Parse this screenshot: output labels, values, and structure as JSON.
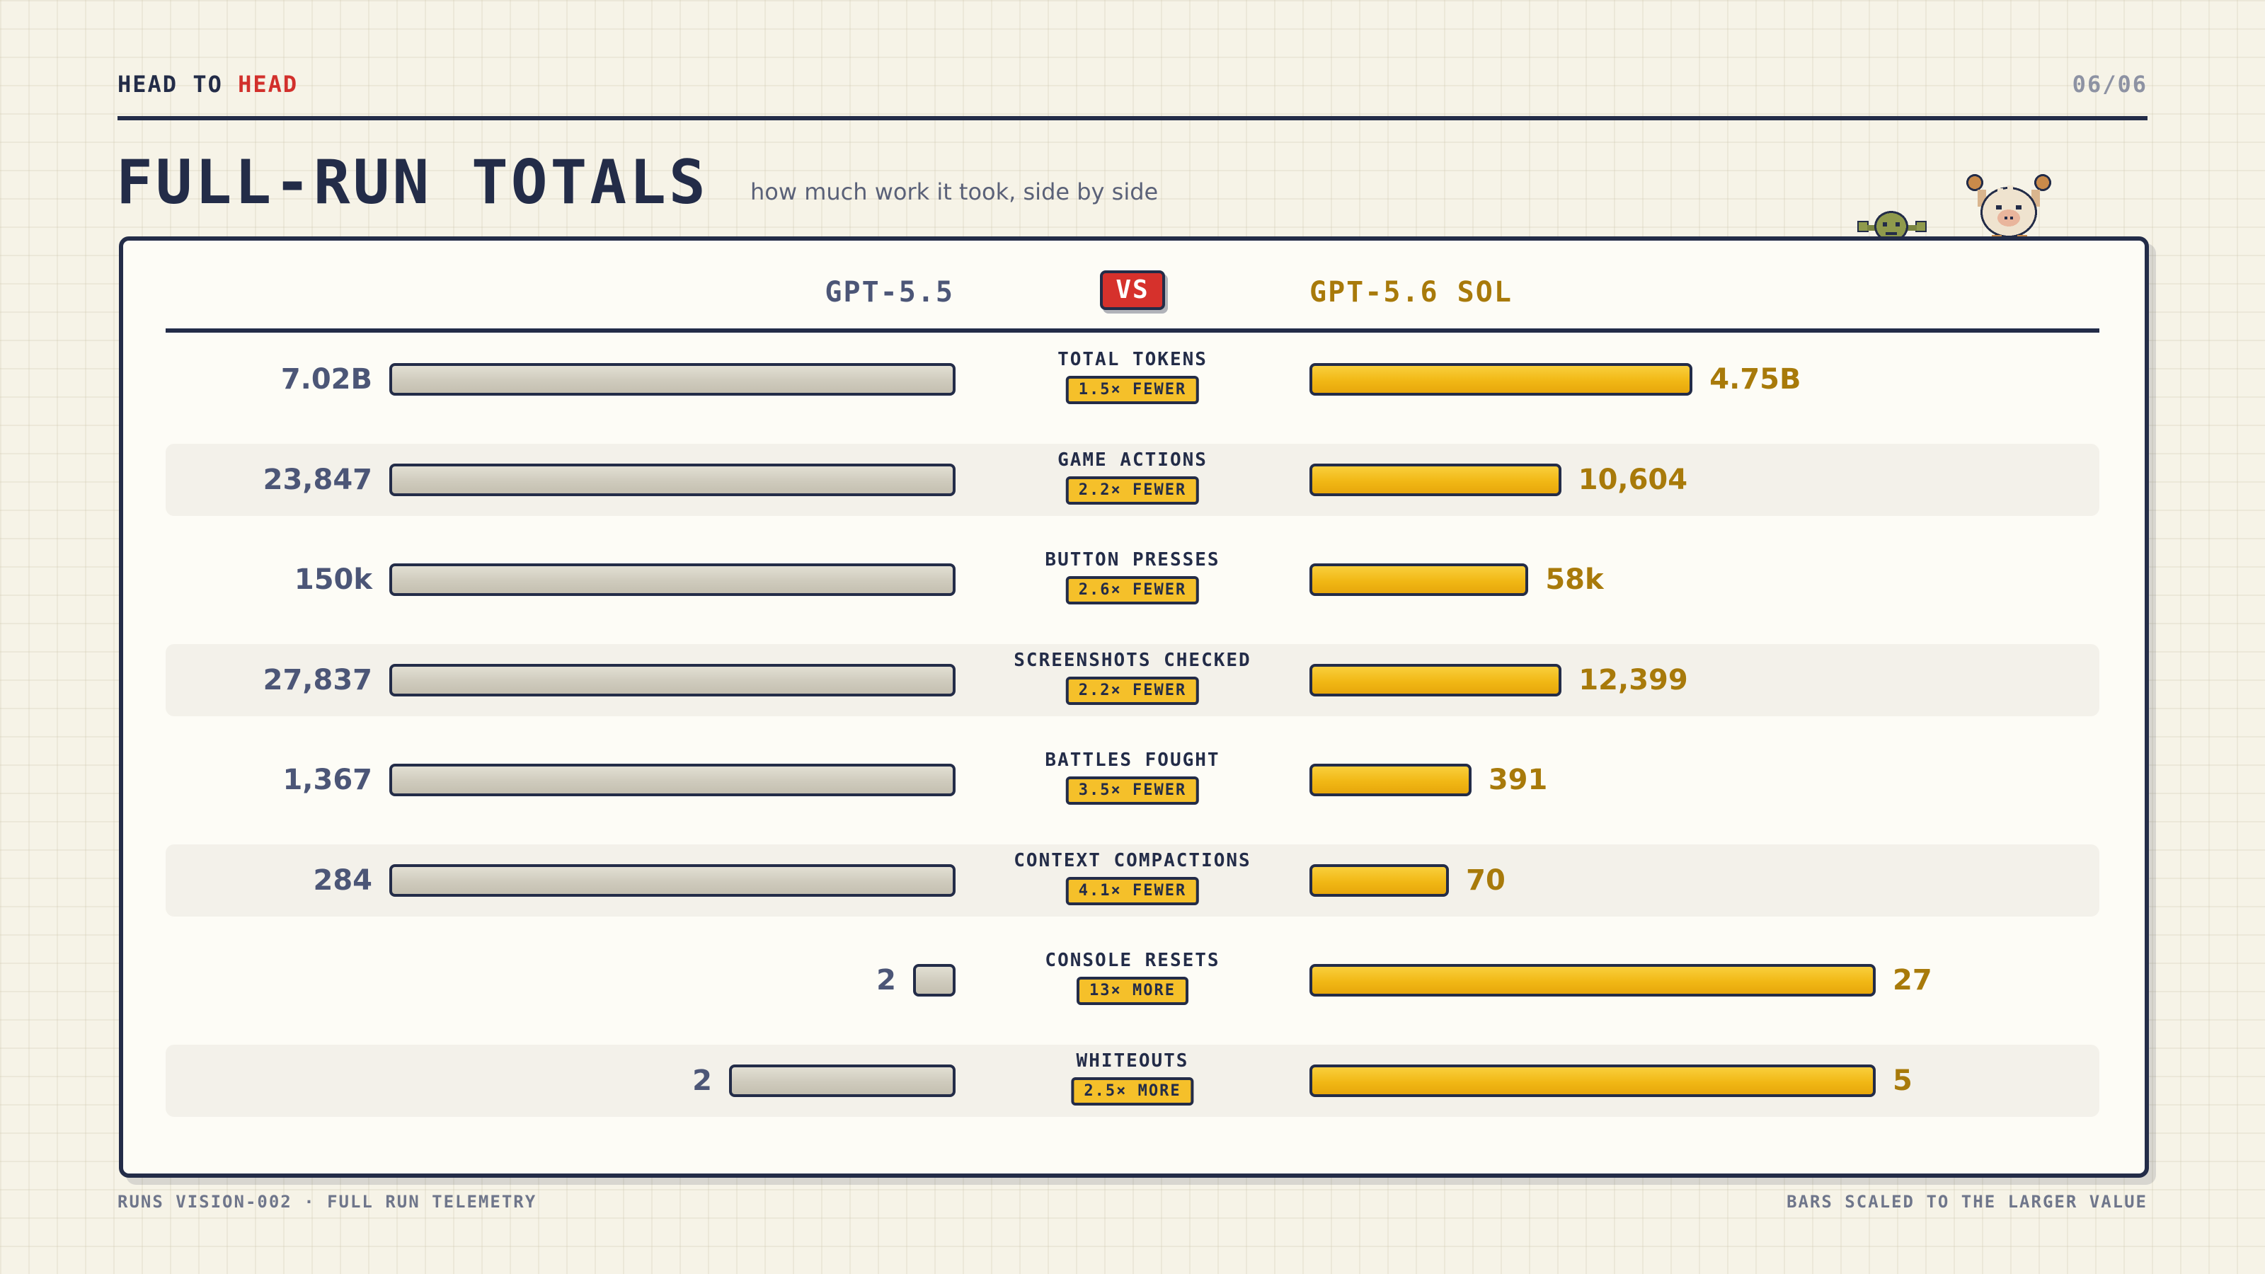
{
  "header": {
    "eyebrow_part1": "HEAD TO ",
    "eyebrow_part2": "HEAD",
    "page_number": "06/06",
    "title": "FULL-RUN TOTALS",
    "subtitle": "how much work it took, side by side"
  },
  "models": {
    "left": "GPT-5.5",
    "vs": "VS",
    "right": "GPT-5.6 SOL"
  },
  "colors": {
    "left_bar": "#cfcbbd",
    "right_bar": "#f1b815",
    "accent_red": "#d6312c",
    "ink": "#232c48"
  },
  "chart_data": {
    "type": "bar",
    "orientation": "horizontal-mirrored",
    "series": [
      {
        "name": "GPT-5.5",
        "values": [
          7020000000,
          23847,
          150000,
          27837,
          1367,
          284,
          2,
          2
        ]
      },
      {
        "name": "GPT-5.6 SOL",
        "values": [
          4750000000,
          10604,
          58000,
          12399,
          391,
          70,
          27,
          5
        ]
      }
    ],
    "scaling": "per-row, bars scaled to the larger value",
    "rows": [
      {
        "metric": "TOTAL TOKENS",
        "left_label": "7.02B",
        "right_label": "4.75B",
        "left": 7020000000,
        "right": 4750000000,
        "badge": "1.5× FEWER"
      },
      {
        "metric": "GAME ACTIONS",
        "left_label": "23,847",
        "right_label": "10,604",
        "left": 23847,
        "right": 10604,
        "badge": "2.2× FEWER"
      },
      {
        "metric": "BUTTON PRESSES",
        "left_label": "150k",
        "right_label": "58k",
        "left": 150000,
        "right": 58000,
        "badge": "2.6× FEWER"
      },
      {
        "metric": "SCREENSHOTS CHECKED",
        "left_label": "27,837",
        "right_label": "12,399",
        "left": 27837,
        "right": 12399,
        "badge": "2.2× FEWER"
      },
      {
        "metric": "BATTLES FOUGHT",
        "left_label": "1,367",
        "right_label": "391",
        "left": 1367,
        "right": 391,
        "badge": "3.5× FEWER"
      },
      {
        "metric": "CONTEXT COMPACTIONS",
        "left_label": "284",
        "right_label": "70",
        "left": 284,
        "right": 70,
        "badge": "4.1× FEWER"
      },
      {
        "metric": "CONSOLE RESETS",
        "left_label": "2",
        "right_label": "27",
        "left": 2,
        "right": 27,
        "badge": "13× MORE"
      },
      {
        "metric": "WHITEOUTS",
        "left_label": "2",
        "right_label": "5",
        "left": 2,
        "right": 5,
        "badge": "2.5× MORE"
      }
    ]
  },
  "footer": {
    "left": "RUNS VISION-002 · FULL RUN TELEMETRY",
    "right": "BARS SCALED TO THE LARGER VALUE"
  }
}
